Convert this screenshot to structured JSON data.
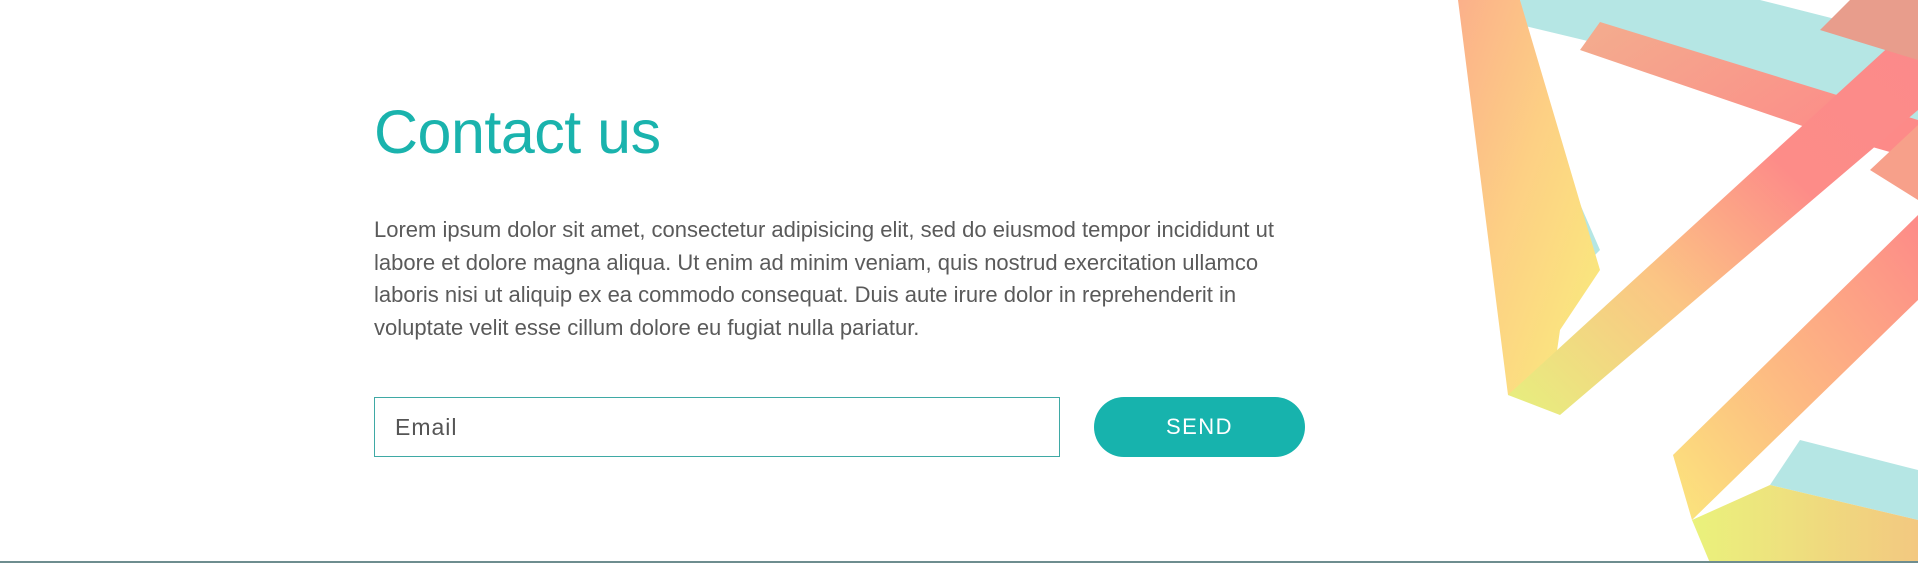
{
  "contact": {
    "title": "Contact us",
    "body": "Lorem ipsum dolor sit amet, consectetur adipisicing elit, sed do eiusmod tempor incididunt ut labore et dolore magna aliqua. Ut enim ad minim veniam, quis nostrud exercitation ullamco laboris nisi ut aliquip ex ea commodo consequat. Duis aute irure dolor in reprehenderit in voluptate velit esse cillum dolore eu fugiat nulla pariatur."
  },
  "form": {
    "email_placeholder": "Email",
    "email_value": "",
    "send_label": "SEND"
  },
  "colors": {
    "accent": "#17b3ad",
    "title": "#1ab3ad",
    "body_text": "#5a5a5a",
    "decor_teal": "#b5e6e4",
    "decor_orange": "#fbb584",
    "decor_pink": "#fb8a8a",
    "decor_yellow": "#fbe37e"
  }
}
